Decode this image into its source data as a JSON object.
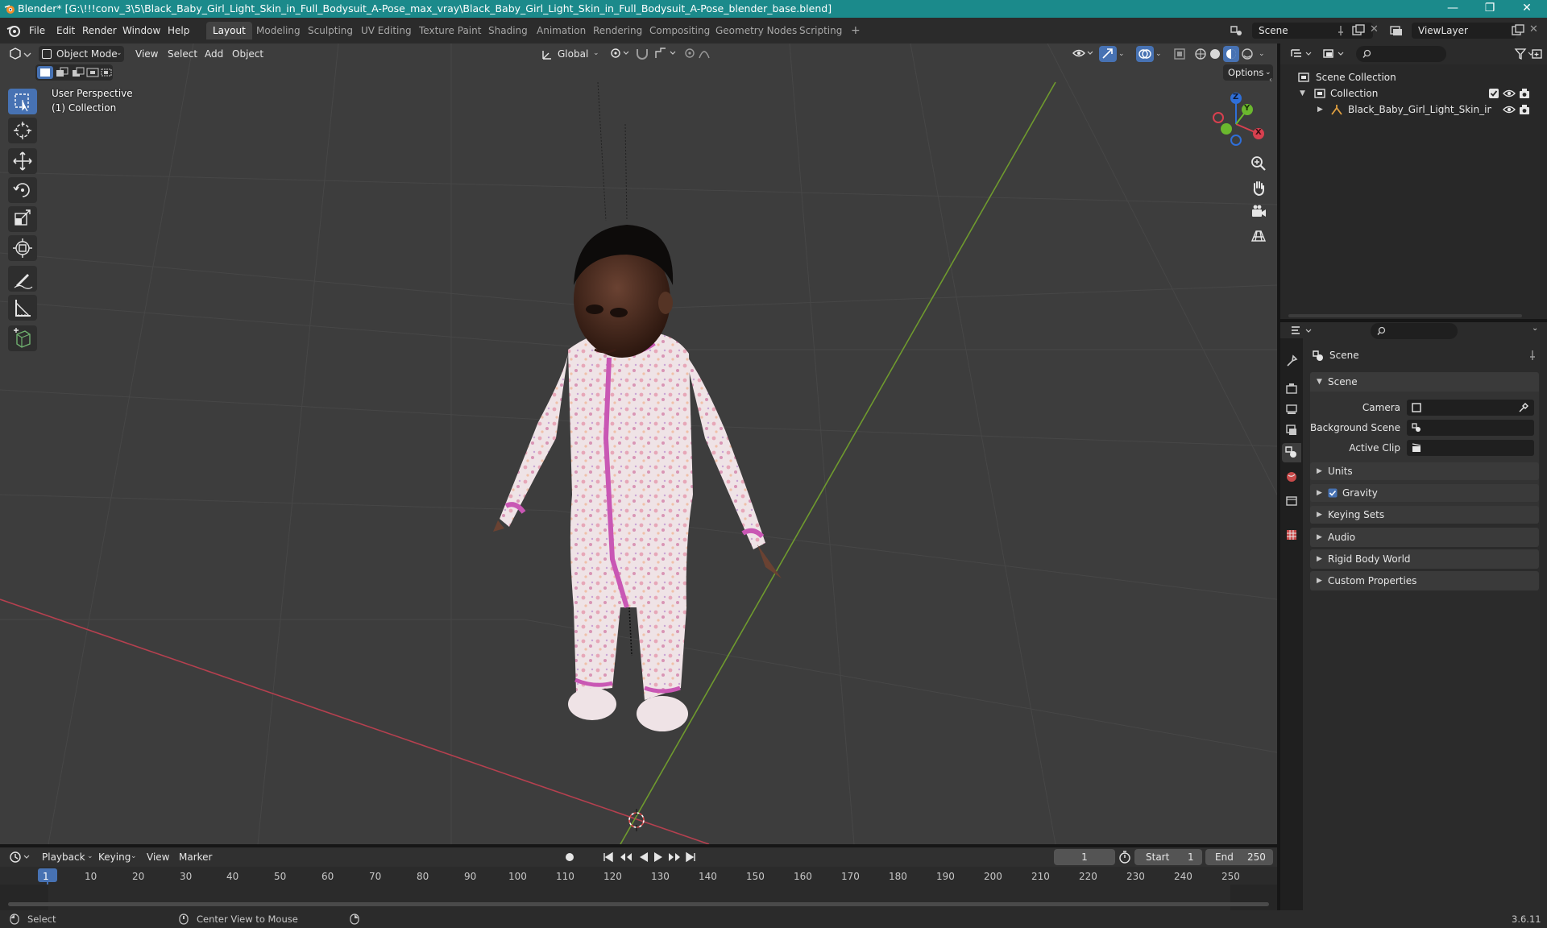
{
  "window": {
    "title": "Blender* [G:\\!!!conv_3\\5\\Black_Baby_Girl_Light_Skin_in_Full_Bodysuit_A-Pose_max_vray\\Black_Baby_Girl_Light_Skin_in_Full_Bodysuit_A-Pose_blender_base.blend]",
    "controls": [
      "—",
      "❐",
      "✕"
    ],
    "titlebar_color": "#1b8a8b"
  },
  "menu": [
    "File",
    "Edit",
    "Render",
    "Window",
    "Help"
  ],
  "workspaces": [
    "Layout",
    "Modeling",
    "Sculpting",
    "UV Editing",
    "Texture Paint",
    "Shading",
    "Animation",
    "Rendering",
    "Compositing",
    "Geometry Nodes",
    "Scripting",
    "+"
  ],
  "active_workspace": "Layout",
  "scene_selector": {
    "value": "Scene"
  },
  "viewlayer_selector": {
    "value": "ViewLayer"
  },
  "viewport": {
    "mode": "Object Mode",
    "menus": [
      "View",
      "Select",
      "Add",
      "Object"
    ],
    "transform_orientation": "Global",
    "options_label": "Options",
    "perspective_label": "User Perspective",
    "collection_label": "(1) Collection",
    "gizmo_axes": {
      "x": "X",
      "y": "Y",
      "z": "Z"
    },
    "colors": {
      "x_axis": "#b5404f",
      "y_axis": "#6f9a2e",
      "active_tool": "#4772b3",
      "background": "#3d3d3d"
    },
    "tools": [
      "select-box-icon",
      "cursor-icon",
      "move-icon",
      "rotate-icon",
      "scale-icon",
      "transform-icon",
      "annotate-icon",
      "measure-icon",
      "add-cube-icon"
    ]
  },
  "outliner": {
    "root": "Scene Collection",
    "collection": "Collection",
    "object": "Black_Baby_Girl_Light_Skin_in_Full_"
  },
  "properties": {
    "context_title": "Scene",
    "section_title": "Scene",
    "fields": [
      {
        "label": "Camera",
        "value": ""
      },
      {
        "label": "Background Scene",
        "value": ""
      },
      {
        "label": "Active Clip",
        "value": ""
      }
    ],
    "panels": [
      "Units",
      "Gravity",
      "Keying Sets",
      "Audio",
      "Rigid Body World",
      "Custom Properties"
    ],
    "gravity_checked": true
  },
  "timeline": {
    "menus": [
      "Playback",
      "Keying",
      "View",
      "Marker"
    ],
    "current_frame": "1",
    "start_label": "Start",
    "start_value": "1",
    "end_label": "End",
    "end_value": "250",
    "ruler": [
      "1",
      "10",
      "20",
      "30",
      "40",
      "50",
      "60",
      "70",
      "80",
      "90",
      "100",
      "110",
      "120",
      "130",
      "140",
      "150",
      "160",
      "170",
      "180",
      "190",
      "200",
      "210",
      "220",
      "230",
      "240",
      "250"
    ]
  },
  "statusbar": {
    "left": "Select",
    "middle": "Center View to Mouse",
    "version": "3.6.11"
  }
}
